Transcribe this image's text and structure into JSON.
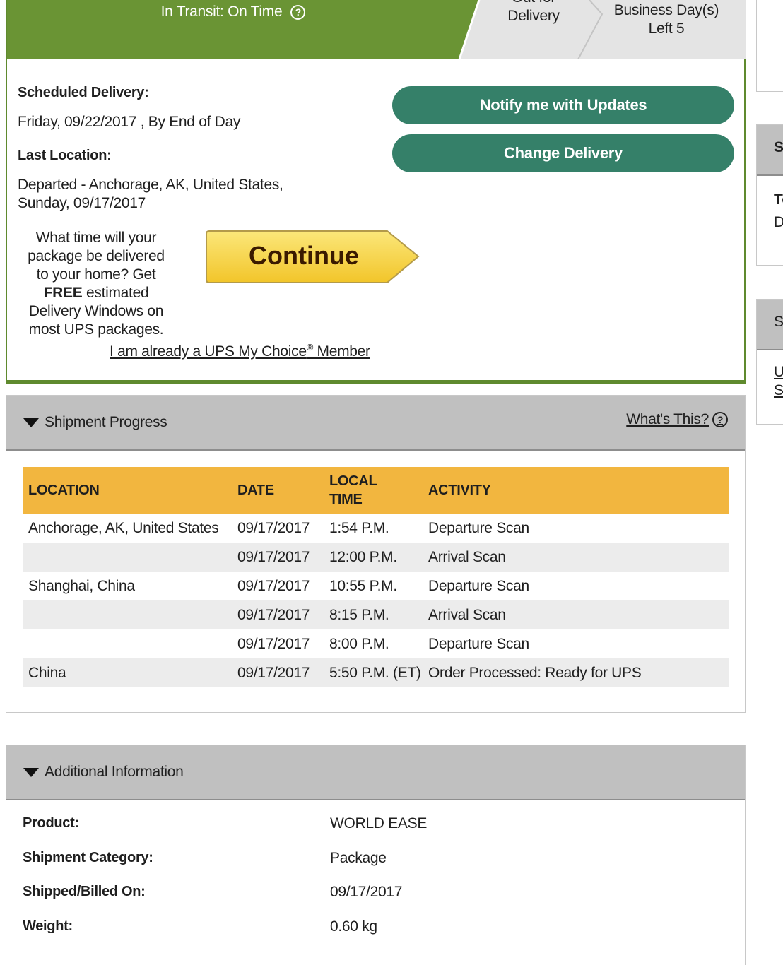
{
  "status": {
    "active_label": "In Transit: On Time",
    "help_icon": "?",
    "out_for_delivery": "Out for Delivery",
    "business_days_left": "Business Day(s) Left 5"
  },
  "delivery": {
    "scheduled_label": "Scheduled Delivery:",
    "scheduled_value": "Friday, 09/22/2017 , By End of Day",
    "last_location_label": "Last Location:",
    "last_location_line1": "Departed - Anchorage, AK, United States,",
    "last_location_line2": "Sunday, 09/17/2017"
  },
  "actions": {
    "notify": "Notify me with Updates",
    "change": "Change Delivery"
  },
  "promo": {
    "text_before": "What time will your package be delivered to your home? Get",
    "text_bold": "FREE",
    "text_after": "estimated Delivery Windows on most UPS packages.",
    "continue": "Continue",
    "member_link_pre": "I am already a UPS My Choice",
    "member_link_sup": "®",
    "member_link_post": " Member"
  },
  "progress": {
    "title": "Shipment Progress",
    "whats_this": "What's This?",
    "columns": [
      "LOCATION",
      "DATE",
      "LOCAL TIME",
      "ACTIVITY"
    ],
    "rows": [
      [
        "Anchorage,  AK,  United States",
        "09/17/2017",
        "1:54 P.M.",
        "Departure Scan"
      ],
      [
        "",
        "09/17/2017",
        "12:00 P.M.",
        "Arrival Scan"
      ],
      [
        "Shanghai,  China",
        "09/17/2017",
        "10:55 P.M.",
        "Departure Scan"
      ],
      [
        "",
        "09/17/2017",
        "8:15 P.M.",
        "Arrival Scan"
      ],
      [
        "",
        "09/17/2017",
        "8:00 P.M.",
        "Departure Scan"
      ],
      [
        "China",
        "09/17/2017",
        "5:50 P.M. (ET)",
        "Order Processed: Ready for UPS"
      ]
    ]
  },
  "additional": {
    "title": "Additional Information",
    "fields": [
      {
        "label": "Product:",
        "value": "WORLD EASE"
      },
      {
        "label": "Shipment Category:",
        "value": "Package"
      },
      {
        "label": "Shipped/Billed On:",
        "value": "09/17/2017"
      },
      {
        "label": "Weight:",
        "value": "0.60 kg"
      }
    ]
  },
  "sidebar": {
    "box2_head": "Sh",
    "box2_line1": "To",
    "box2_line2": "D",
    "box3_head": "Se",
    "box3_line1": "U",
    "box3_line2": "Sa"
  },
  "colors": {
    "status_green": "#5f8a2e",
    "button_green": "#358069",
    "table_header": "#f2b63f",
    "continue_yellow": "#f5cf3a"
  }
}
